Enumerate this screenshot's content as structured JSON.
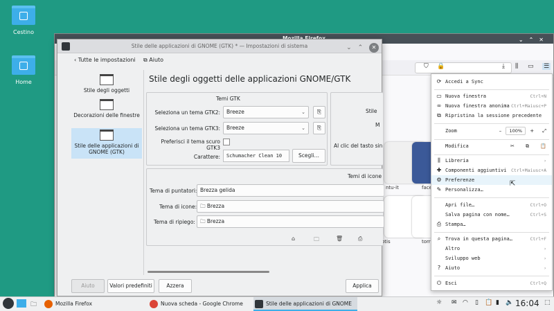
{
  "desktop": {
    "icons": [
      {
        "label": "Cestino",
        "icon": "trash-icon"
      },
      {
        "label": "Home",
        "icon": "home-folder-icon"
      }
    ]
  },
  "firefox": {
    "title": "Mozilla Firefox",
    "tiles": [
      {
        "label": "ntu-it"
      },
      {
        "label": "face"
      },
      {
        "label": "otis"
      },
      {
        "label": "torr"
      }
    ],
    "menu": {
      "items": [
        {
          "label": "Accedi a Sync",
          "shortcut": "",
          "icon": "sync-icon"
        },
        {
          "label": "Nuova finestra",
          "shortcut": "Ctrl+N",
          "icon": "new-window-icon"
        },
        {
          "label": "Nuova finestra anonima",
          "shortcut": "Ctrl+Maiusc+P",
          "icon": "private-window-icon"
        },
        {
          "label": "Ripristina la sessione precedente",
          "shortcut": "",
          "icon": "restore-session-icon"
        },
        {
          "label": "Zoom",
          "shortcut": "",
          "icon": ""
        },
        {
          "label": "Modifica",
          "shortcut": "",
          "icon": ""
        },
        {
          "label": "Libreria",
          "shortcut": "›",
          "icon": "library-icon"
        },
        {
          "label": "Componenti aggiuntivi",
          "shortcut": "Ctrl+Maiusc+A",
          "icon": "addons-icon"
        },
        {
          "label": "Preferenze",
          "shortcut": "",
          "icon": "gear-icon"
        },
        {
          "label": "Personalizza…",
          "shortcut": "",
          "icon": "brush-icon"
        },
        {
          "label": "Apri file…",
          "shortcut": "Ctrl+O",
          "icon": ""
        },
        {
          "label": "Salva pagina con nome…",
          "shortcut": "Ctrl+S",
          "icon": ""
        },
        {
          "label": "Stampa…",
          "shortcut": "",
          "icon": "print-icon"
        },
        {
          "label": "Trova in questa pagina…",
          "shortcut": "Ctrl+F",
          "icon": "search-icon"
        },
        {
          "label": "Altro",
          "shortcut": "›",
          "icon": ""
        },
        {
          "label": "Sviluppo web",
          "shortcut": "›",
          "icon": ""
        },
        {
          "label": "Aiuto",
          "shortcut": "›",
          "icon": "help-icon"
        },
        {
          "label": "Esci",
          "shortcut": "Ctrl+Q",
          "icon": "power-icon"
        }
      ],
      "zoom_value": "100%",
      "zoom_minus": "–",
      "zoom_plus": "+"
    }
  },
  "settings": {
    "window_title": "Stile delle applicazioni di GNOME (GTK) * — Impostazioni di sistema",
    "nav": {
      "back_label": "Tutte le impostazioni",
      "help_label": "Aiuto"
    },
    "sidebar": [
      {
        "label": "Stile degli oggetti"
      },
      {
        "label": "Decorazioni delle finestre"
      },
      {
        "label": "Stile delle applicazioni di GNOME (GTK)"
      }
    ],
    "page_title": "Stile degli oggetti delle applicazioni GNOME/GTK",
    "gtk_group": {
      "title": "Temi GTK",
      "gtk2_label": "Seleziona un tema GTK2:",
      "gtk2_value": "Breeze",
      "gtk3_label": "Seleziona un tema GTK3:",
      "gtk3_value": "Breeze",
      "dark_label": "Preferisci il tema scuro GTK3",
      "font_label": "Carattere:",
      "font_value": "Schumacher Clean 10",
      "choose_label": "Scegli…"
    },
    "right_group": {
      "line1": "Stile",
      "line2": "M",
      "line3": "Al clic del tasto sin"
    },
    "icons_group": {
      "title": "Temi di icone",
      "cursor_label": "Tema di puntatori:",
      "cursor_value": "Brezza gelida",
      "icon_label": "Tema di icone:",
      "icon_value": "Brezza",
      "fallback_label": "Tema di ripiego:",
      "fallback_value": "Brezza"
    },
    "buttons": {
      "help": "Aiuto",
      "defaults": "Valori predefiniti",
      "reset": "Azzera",
      "apply": "Applica"
    }
  },
  "taskbar": {
    "items": [
      {
        "label": "Mozilla Firefox"
      },
      {
        "label": "Nuova scheda - Google Chrome"
      },
      {
        "label": "Stile delle applicazioni di GNOME (..."
      }
    ],
    "clock": "16:04"
  },
  "colors": {
    "desktop_bg": "#1f9a83",
    "accent": "#3daee9",
    "selection": "#c9e3f7"
  }
}
